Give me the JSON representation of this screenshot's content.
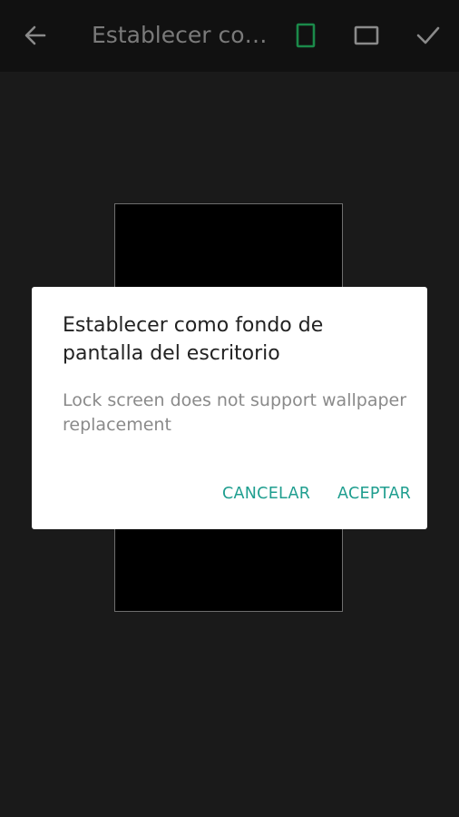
{
  "appbar": {
    "title": "Establecer com…",
    "icons": {
      "back": "arrow-back-icon",
      "portrait": "phone-portrait-icon",
      "landscape": "rectangle-crop-icon",
      "confirm": "checkmark-icon"
    }
  },
  "dialog": {
    "title": "Establecer como fondo de pantalla del escritorio",
    "message": "Lock screen does not support wallpaper replacement",
    "cancel_label": "CANCELAR",
    "accept_label": "ACEPTAR"
  },
  "colors": {
    "accent": "#1f9e8f",
    "portrait_selected": "#1b8a4a",
    "background": "#1a1a1a",
    "appbar": "#111111"
  }
}
